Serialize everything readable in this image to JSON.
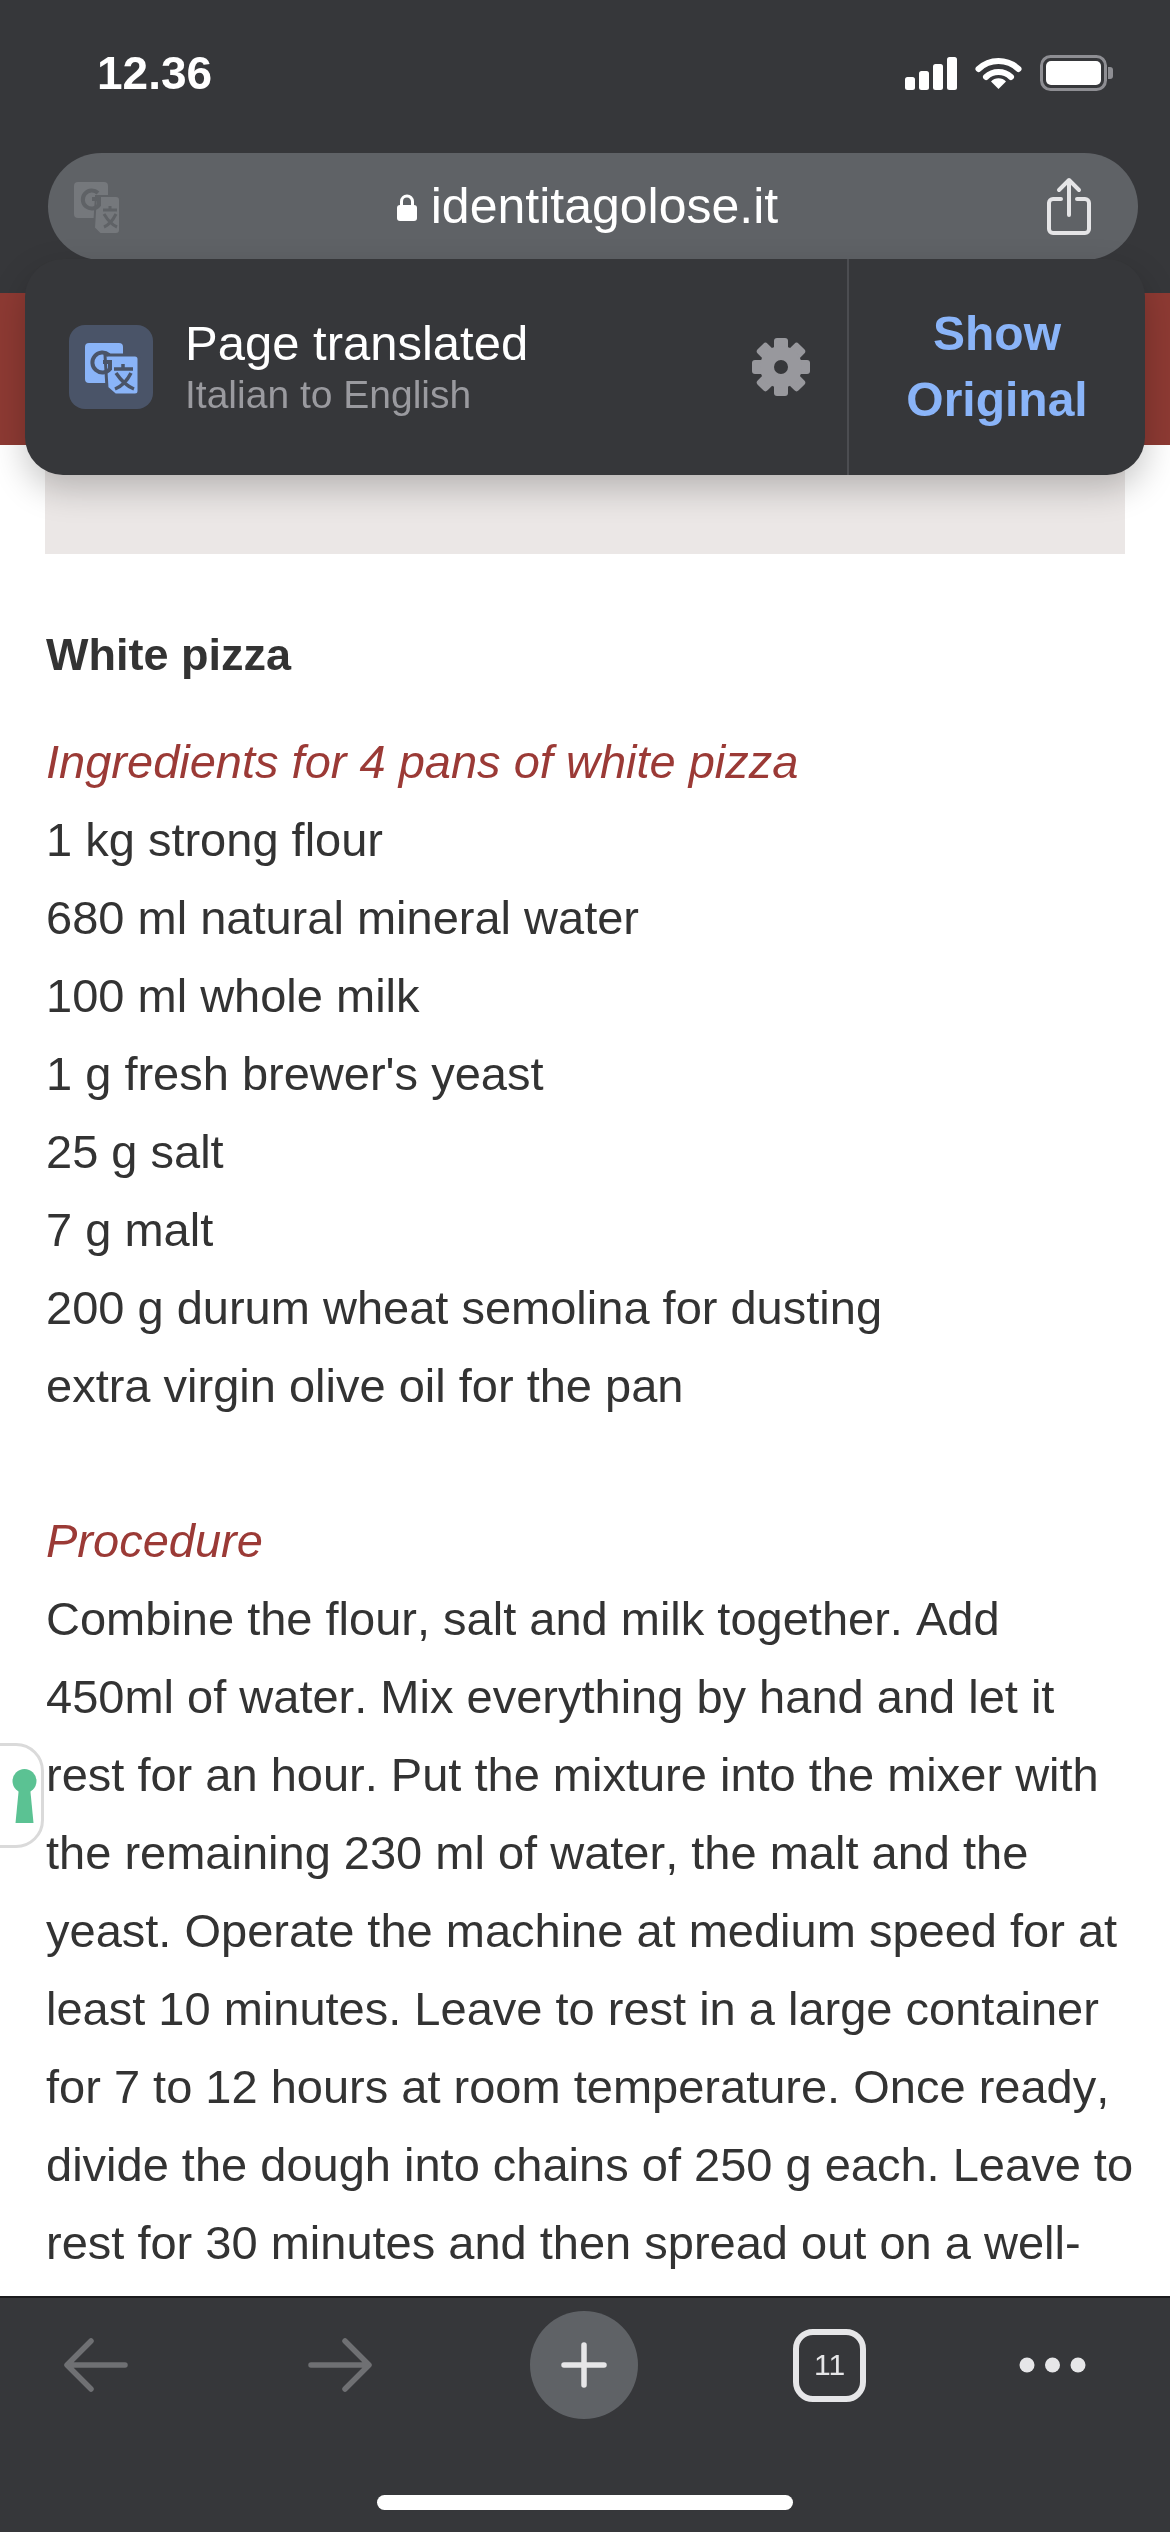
{
  "status_bar": {
    "time": "12.36"
  },
  "address_bar": {
    "url": "identitagolose.it"
  },
  "translation_banner": {
    "title": "Page translated",
    "subtitle": "Italian to English",
    "action": "Show Original"
  },
  "article": {
    "title": "White pizza",
    "ingredients_heading": "Ingredients for 4 pans of white pizza",
    "ingredients": [
      "1 kg strong flour",
      "680 ml natural mineral water",
      "100 ml whole milk",
      "1 g fresh brewer's yeast",
      "25 g salt",
      "7 g malt",
      "200 g durum wheat semolina for dusting",
      "extra virgin olive oil for the pan"
    ],
    "procedure_heading": "Procedure",
    "procedure": "Combine the flour, salt and milk together. Add 450ml of water. Mix everything by hand and let it rest for an hour. Put the mixture into the mixer with the remaining 230 ml of water, the malt and the yeast. Operate the machine at medium speed for at least 10 minutes. Leave to rest in a large container for 7 to 12 hours at room temperature. Once ready, divide the dough into chains of 250 g each. Leave to rest for 30 minutes and then spread out on a well-"
  },
  "toolbar": [
    {
      "kind": "back",
      "disabled": true
    },
    {
      "kind": "forward",
      "disabled": true
    },
    {
      "kind": "new-tab",
      "disabled": false
    },
    {
      "kind": "tabs",
      "label": "11",
      "disabled": false
    },
    {
      "kind": "more",
      "disabled": false
    }
  ]
}
